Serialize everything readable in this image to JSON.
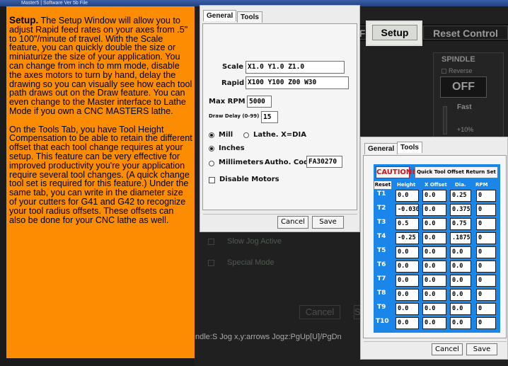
{
  "window": {
    "title": "Master5 | Software Ver 5b File"
  },
  "background": {
    "buttons": {
      "left": "F",
      "setup": "Setup",
      "reset": "Reset Control"
    },
    "spindle": {
      "title": "SPINDLE",
      "reverse": "Reverse",
      "off": "OFF",
      "fast": "Fast",
      "percent": "+10%"
    },
    "rows": [
      "Slow Jog Active",
      "Special Mode"
    ],
    "dialog_buttons": {
      "cancel": "Cancel",
      "save": "S"
    },
    "status_bar": "ndle:S  Jog x,y:arrows  Jogz:PgUp[U]/PgDn"
  },
  "description": {
    "title": "Setup.",
    "para1": "The Setup Window will allow you to adjust Rapid feed rates on your axes from .5\" to 100\"/minute of travel.  With the Scale feature, you can quickly double the size or miniaturize the size of your application.  You can change from inch to mm mode, disable the axes motors to turn by hand, delay the drawing so you can visually see how each tool path draws out on the Draw feature.  You can even change to the Master interface to Lathe Mode if you own a CNC MASTERS lathe.",
    "para2": "On the Tools Tab, you have Tool Height Compensation to be able to retain the different offset that each tool change requires at your setup.  This feature can be very effective for improved productivity you're your application require several tool changes.  (A quick change tool set is required for this feature.)  Under the same tab, you can write in the diameter size of your cutters for G41 and G42 to recognize your tool radius offsets.  These offsets can also be done for your CNC lathe as well."
  },
  "general_dialog": {
    "tabs": [
      "General",
      "Tools"
    ],
    "scale": {
      "label": "Scale",
      "value": "X1.0 Y1.0 Z1.0"
    },
    "rapid": {
      "label": "Rapid",
      "value": "X100 Y100 Z00 W30"
    },
    "max_rpm": {
      "label": "Max RPM",
      "value": "5000"
    },
    "draw_delay": {
      "label": "Draw Delay (0-99)",
      "value": "15"
    },
    "mode": {
      "mill": "Mill",
      "lathe": "Lathe.  X=DIA",
      "selected": "mill"
    },
    "units": {
      "inches": "Inches",
      "millimeters": "Millimeters",
      "selected": "inches"
    },
    "auth": {
      "label": "Autho. Code",
      "value": "FA30270"
    },
    "disable_motors": {
      "label": "Disable Motors",
      "checked": false
    },
    "buttons": {
      "cancel": "Cancel",
      "save": "Save"
    }
  },
  "tools_dialog": {
    "tabs": [
      "General",
      "Tools"
    ],
    "caution": "CAUTION!",
    "quick_offset": "Quick Tool Offset Return Set",
    "reset": "Reset",
    "headers": [
      "Height",
      "X Offset",
      "Dia.",
      "RPM"
    ],
    "rows": [
      {
        "tool": "T1",
        "height": "0.0",
        "x_offset": "0.0",
        "dia": "0.25",
        "rpm": "0"
      },
      {
        "tool": "T2",
        "height": "-0.030",
        "x_offset": "0.0",
        "dia": "0.375",
        "rpm": "0"
      },
      {
        "tool": "T3",
        "height": "0.5",
        "x_offset": "0.0",
        "dia": "0.75",
        "rpm": "0"
      },
      {
        "tool": "T4",
        "height": "-0.25",
        "x_offset": "0.0",
        "dia": ".1875",
        "rpm": "0"
      },
      {
        "tool": "T5",
        "height": "0.0",
        "x_offset": "0.0",
        "dia": "0.0",
        "rpm": "0"
      },
      {
        "tool": "T6",
        "height": "0.0",
        "x_offset": "0.0",
        "dia": "0.0",
        "rpm": "0"
      },
      {
        "tool": "T7",
        "height": "0.0",
        "x_offset": "0.0",
        "dia": "0.0",
        "rpm": "0"
      },
      {
        "tool": "T8",
        "height": "0.0",
        "x_offset": "0.0",
        "dia": "0.0",
        "rpm": "0"
      },
      {
        "tool": "T9",
        "height": "0.0",
        "x_offset": "0.0",
        "dia": "0.0",
        "rpm": "0"
      },
      {
        "tool": "T10",
        "height": "0.0",
        "x_offset": "0.0",
        "dia": "0.0",
        "rpm": "0"
      }
    ],
    "buttons": {
      "cancel": "Cancel",
      "save": "Save"
    }
  },
  "colors": {
    "orange": "#fc8c02",
    "tools_blue": "#1b86ea",
    "caution_red": "#c8161d"
  }
}
